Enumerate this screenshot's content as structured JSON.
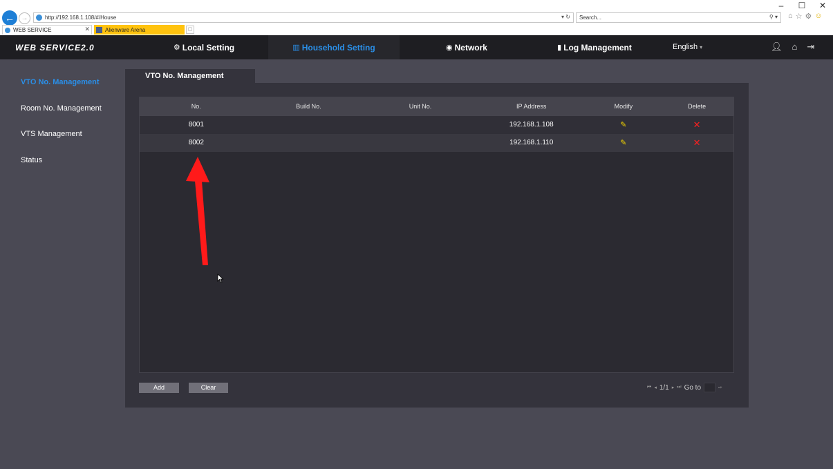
{
  "browser": {
    "window_controls": [
      "–",
      "☐",
      "✕"
    ],
    "address": "http://192.168.1.108/#/House",
    "address_tools": "▾ ↻",
    "search_placeholder": "Search...",
    "search_tools": "⚲ ▾",
    "tabs": [
      {
        "label": "WEB SERVICE",
        "close": "✕"
      },
      {
        "label": "Alienware Arena"
      }
    ],
    "toolbar_icons": [
      "home-icon",
      "star-icon",
      "gear-icon",
      "smiley-icon"
    ]
  },
  "app": {
    "logo": "WEB SERVICE2.0",
    "nav": {
      "local": "Local Setting",
      "household": "Household Setting",
      "network": "Network",
      "log": "Log Management"
    },
    "language": "English",
    "language_caret": "▾",
    "accent_color": "#2a8fe8"
  },
  "sidebar": {
    "items": [
      {
        "label": "VTO No. Management",
        "active": true
      },
      {
        "label": "Room No. Management"
      },
      {
        "label": "VTS Management"
      },
      {
        "label": "Status"
      }
    ]
  },
  "panel": {
    "tab_title": "VTO No. Management",
    "table": {
      "headers": {
        "no": "No.",
        "build": "Build No.",
        "unit": "Unit No.",
        "ip": "IP Address",
        "modify": "Modify",
        "delete": "Delete"
      },
      "rows": [
        {
          "no": "8001",
          "build": "",
          "unit": "",
          "ip": "192.168.1.108",
          "modify_icon": "✎",
          "delete_icon": "✕"
        },
        {
          "no": "8002",
          "build": "",
          "unit": "",
          "ip": "192.168.1.110",
          "modify_icon": "✎",
          "delete_icon": "✕"
        }
      ]
    },
    "buttons": {
      "add": "Add",
      "clear": "Clear"
    },
    "pager": {
      "first": "⏮",
      "prev": "◂",
      "page": "1/1",
      "next": "▸",
      "last": "⏭",
      "goto_label": "Go to",
      "go": "⇨"
    }
  }
}
